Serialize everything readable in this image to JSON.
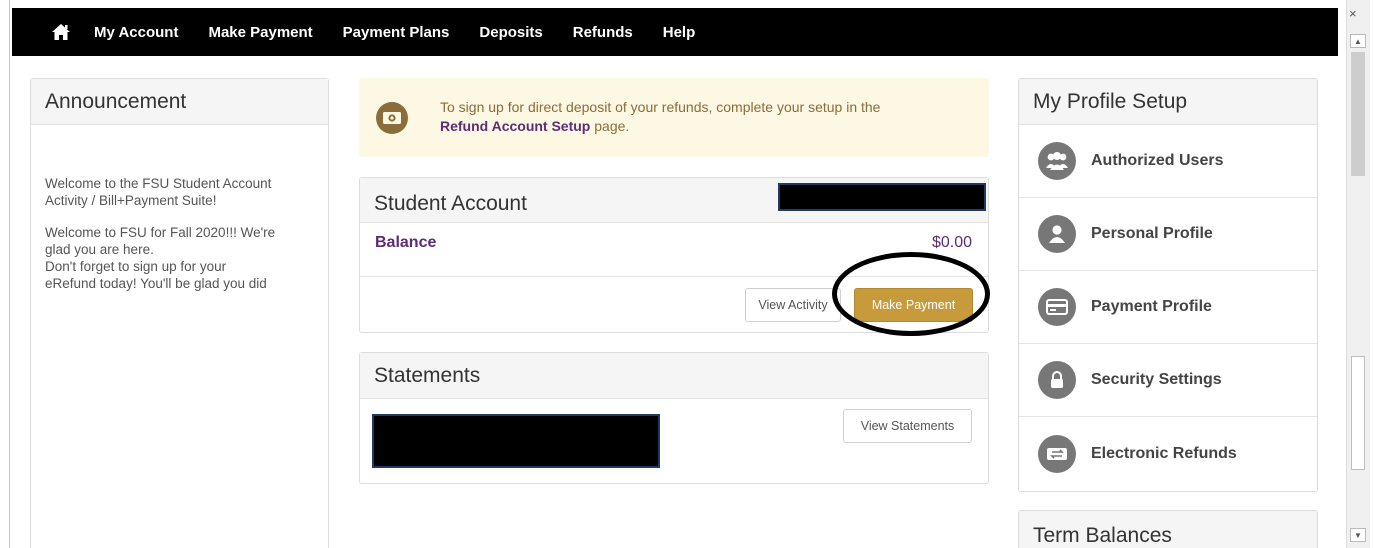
{
  "nav": {
    "home_icon": "home-icon",
    "items": [
      "My Account",
      "Make Payment",
      "Payment Plans",
      "Deposits",
      "Refunds",
      "Help"
    ]
  },
  "window": {
    "close_glyph": "×"
  },
  "announcement": {
    "title": "Announcement",
    "para1_line1": "Welcome to the FSU Student Account",
    "para1_line2": "Activity / Bill+Payment Suite!",
    "para2_line1": "Welcome to FSU for Fall 2020!!! We're",
    "para2_line2": "glad you are here.",
    "para2_line3": "Don't forget to sign up for your",
    "para2_line4": "eRefund today! You'll be glad you did"
  },
  "notice": {
    "icon": "money-icon",
    "text_before": "To sign up for direct deposit of your refunds, complete your setup in the",
    "link_text": "Refund Account Setup",
    "text_after": " page."
  },
  "student_account": {
    "title": "Student Account",
    "balance_label": "Balance",
    "balance_value": "$0.00",
    "view_activity": "View Activity",
    "make_payment": "Make Payment"
  },
  "statements": {
    "title": "Statements",
    "view_statements": "View Statements"
  },
  "profile_setup": {
    "title": "My Profile Setup",
    "items": [
      {
        "label": "Authorized Users",
        "icon": "users-icon"
      },
      {
        "label": "Personal Profile",
        "icon": "user-icon"
      },
      {
        "label": "Payment Profile",
        "icon": "credit-card-icon"
      },
      {
        "label": "Security Settings",
        "icon": "lock-icon"
      },
      {
        "label": "Electronic Refunds",
        "icon": "refund-icon"
      }
    ]
  },
  "term_balances": {
    "title": "Term Balances"
  },
  "colors": {
    "nav_bg": "#000000",
    "link_purple": "#5c2d76",
    "gold": "#c79a3c",
    "notice_bg": "#fcf8e3"
  }
}
